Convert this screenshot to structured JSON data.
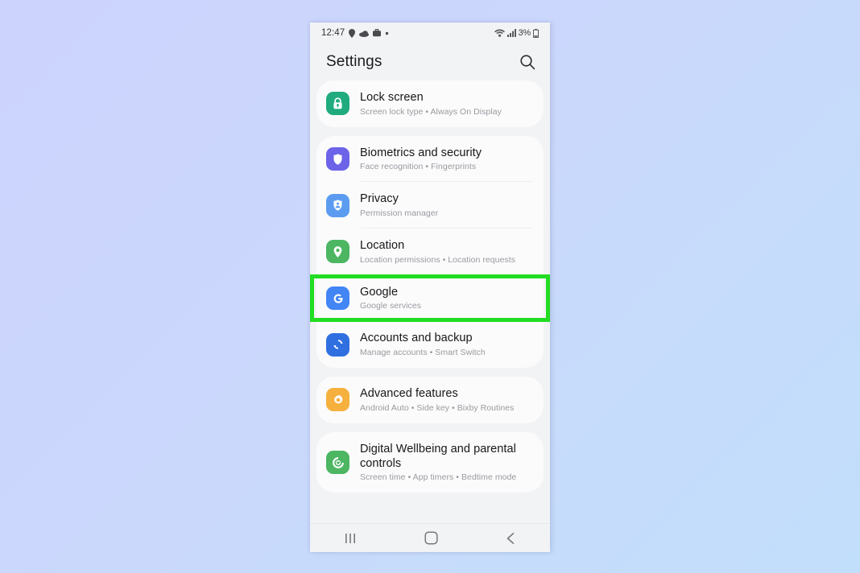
{
  "status_bar": {
    "time": "12:47",
    "left_icons": [
      "location-pin-icon",
      "cloud-icon",
      "work-briefcase-icon",
      "dot-icon"
    ],
    "right_icons": [
      "wifi-icon",
      "signal-bars-icon"
    ],
    "battery_percent": "3%",
    "battery_icon": "battery-icon"
  },
  "header": {
    "title": "Settings",
    "search_icon": "search-icon"
  },
  "highlight": {
    "target": "Google",
    "color": "#22dd22"
  },
  "cards": [
    {
      "rows": [
        {
          "title": "Lock screen",
          "subtitle": "Screen lock type  •  Always On Display",
          "icon": "lock-icon",
          "icon_color": "#1fab7e",
          "highlighted": false
        }
      ]
    },
    {
      "rows": [
        {
          "title": "Biometrics and security",
          "subtitle": "Face recognition  •  Fingerprints",
          "icon": "shield-icon",
          "icon_color": "#6c63e8",
          "highlighted": false
        },
        {
          "title": "Privacy",
          "subtitle": "Permission manager",
          "icon": "privacy-shield-person-icon",
          "icon_color": "#5b9cf0",
          "highlighted": false
        },
        {
          "title": "Location",
          "subtitle": "Location permissions  •  Location requests",
          "icon": "location-pin-icon",
          "icon_color": "#4cb662",
          "highlighted": false
        },
        {
          "title": "Google",
          "subtitle": "Google services",
          "icon": "google-g-icon",
          "icon_color": "#4285f4",
          "highlighted": true
        },
        {
          "title": "Accounts and backup",
          "subtitle": "Manage accounts  •  Smart Switch",
          "icon": "sync-arrows-icon",
          "icon_color": "#2f6fe0",
          "highlighted": false
        }
      ]
    },
    {
      "rows": [
        {
          "title": "Advanced features",
          "subtitle": "Android Auto  •  Side key  •  Bixby Routines",
          "icon": "gear-icon",
          "icon_color": "#f5b03e",
          "highlighted": false
        }
      ]
    },
    {
      "rows": [
        {
          "title": "Digital Wellbeing and parental controls",
          "subtitle": "Screen time  •  App timers  •  Bedtime mode",
          "icon": "wellbeing-circle-icon",
          "icon_color": "#4cb662",
          "highlighted": false
        }
      ]
    }
  ],
  "nav_bar": {
    "recents_icon": "recents-icon",
    "home_icon": "home-icon",
    "back_icon": "back-icon"
  }
}
